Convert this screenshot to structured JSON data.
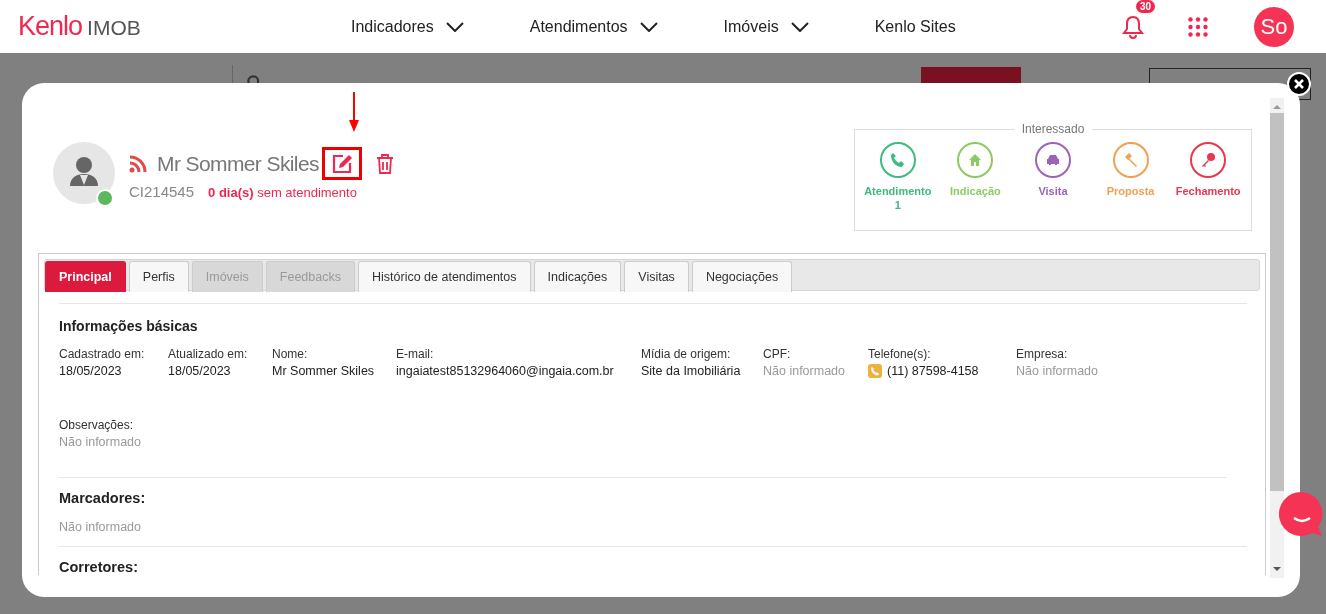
{
  "header": {
    "logo": {
      "brand": "Kenlo",
      "product": "IMOB"
    },
    "nav": [
      {
        "label": "Indicadores",
        "dropdown": true
      },
      {
        "label": "Atendimentos",
        "dropdown": true
      },
      {
        "label": "Imóveis",
        "dropdown": true
      },
      {
        "label": "Kenlo Sites",
        "dropdown": false
      }
    ],
    "notifications": "30",
    "user_initials": "So"
  },
  "modal": {
    "client": {
      "name": "Mr Sommer Skiles",
      "code": "CI214545",
      "days_without_service": "**0 dia(s)** sem atendimento",
      "online": true
    },
    "funnel": {
      "title": "Interessado",
      "stages": [
        {
          "kind": "phone",
          "label": "Atendimento",
          "count": "1",
          "color": "#3dbb7e"
        },
        {
          "kind": "home",
          "label": "Indicação",
          "color": "#8ccb63"
        },
        {
          "kind": "car",
          "label": "Visita",
          "color": "#9d63b8"
        },
        {
          "kind": "gavel",
          "label": "Proposta",
          "color": "#f0a050"
        },
        {
          "kind": "key",
          "label": "Fechamento",
          "color": "#e8384f"
        }
      ]
    },
    "tabs": [
      {
        "label": "Principal",
        "selected": true,
        "disabled": false
      },
      {
        "label": "Perfis",
        "selected": false,
        "disabled": false
      },
      {
        "label": "Imóveis",
        "selected": false,
        "disabled": true
      },
      {
        "label": "Feedbacks",
        "selected": false,
        "disabled": true
      },
      {
        "label": "Histórico de atendimentos",
        "selected": false,
        "disabled": false
      },
      {
        "label": "Indicações",
        "selected": false,
        "disabled": false
      },
      {
        "label": "Visitas",
        "selected": false,
        "disabled": false
      },
      {
        "label": "Negociações",
        "selected": false,
        "disabled": false
      }
    ],
    "basic_info": {
      "title": "Informações básicas",
      "fields": [
        {
          "label": "Cadastrado em:",
          "value": "18/05/2023",
          "empty": false
        },
        {
          "label": "Atualizado em:",
          "value": "18/05/2023",
          "empty": false
        },
        {
          "label": "Nome:",
          "value": "Mr Sommer Skiles",
          "empty": false
        },
        {
          "label": "E-mail:",
          "value": "ingaiatest85132964060@ingaia.com.br",
          "empty": false
        },
        {
          "label": "Mídia de origem:",
          "value": "Site da Imobiliária",
          "empty": false
        },
        {
          "label": "CPF:",
          "value": "Não informado",
          "empty": true
        },
        {
          "label": "Telefone(s):",
          "value": "(11) 87598-4158",
          "empty": false,
          "kind": "phone"
        },
        {
          "label": "Empresa:",
          "value": "Não informado",
          "empty": true
        }
      ],
      "notes": {
        "label": "Observações:",
        "value": "Não informado",
        "empty": true
      }
    },
    "tags": {
      "title": "Marcadores:",
      "value": "Não informado"
    },
    "brokers": {
      "title": "Corretores:"
    }
  }
}
